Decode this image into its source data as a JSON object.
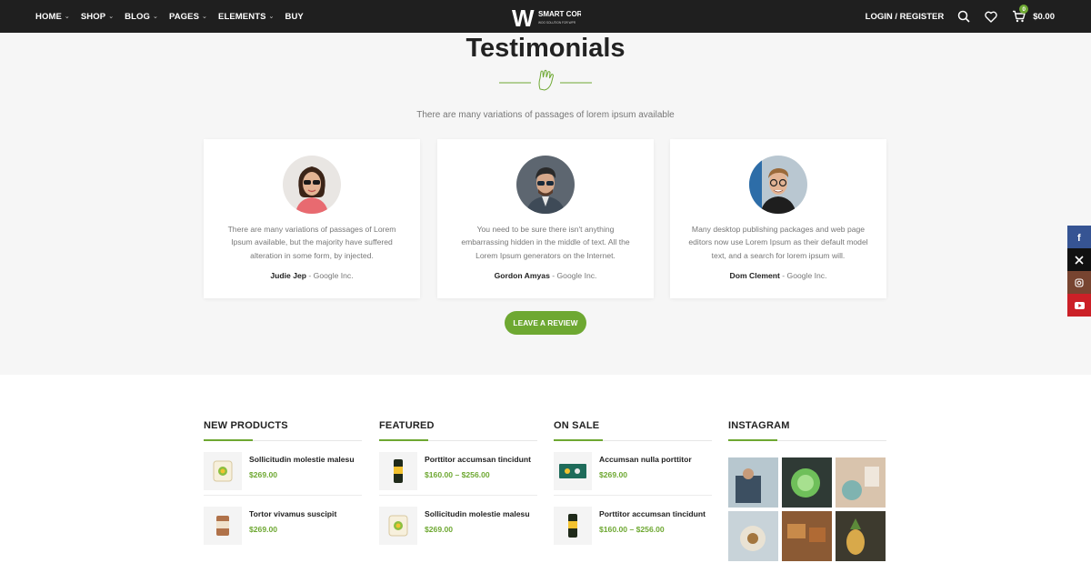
{
  "header": {
    "nav": [
      {
        "label": "HOME",
        "caret": true
      },
      {
        "label": "SHOP",
        "caret": true
      },
      {
        "label": "BLOG",
        "caret": true
      },
      {
        "label": "PAGES",
        "caret": true
      },
      {
        "label": "ELEMENTS",
        "caret": true
      },
      {
        "label": "BUY",
        "caret": false
      }
    ],
    "logo": {
      "mark": "W",
      "name": "SMART CORP",
      "tagline": "WOO SOLUTION FOR WPR"
    },
    "login_label": "LOGIN / REGISTER",
    "cart_count": "0",
    "cart_total": "$0.00",
    "icons": [
      "search-icon",
      "heart-icon",
      "cart-icon"
    ]
  },
  "testimonials": {
    "title": "Testimonials",
    "subtitle": "There are many variations of passages of lorem ipsum available",
    "items": [
      {
        "quote": "There are many variations of passages of Lorem Ipsum available, but the majority have suffered alteration in some form, by injected.",
        "name": "Judie Jep",
        "company": " - Google Inc."
      },
      {
        "quote": "You need to be sure there isn't anything embarrassing hidden in the middle of text. All the Lorem Ipsum generators on the Internet.",
        "name": "Gordon Amyas",
        "company": " - Google Inc."
      },
      {
        "quote": "Many desktop publishing packages and web page editors now use Lorem Ipsum as their default model text, and a search for lorem ipsum will.",
        "name": "Dom Clement",
        "company": " - Google Inc."
      }
    ],
    "button_label": "LEAVE A REVIEW"
  },
  "social": [
    {
      "icon": "facebook-icon",
      "glyph": "f",
      "color": "#365493"
    },
    {
      "icon": "x-icon",
      "glyph": "X",
      "color": "#111111"
    },
    {
      "icon": "instagram-icon",
      "glyph": "◎",
      "color": "#774430"
    },
    {
      "icon": "youtube-icon",
      "glyph": "▶",
      "color": "#cb2027"
    }
  ],
  "columns": {
    "new_products": {
      "title": "NEW PRODUCTS",
      "items": [
        {
          "name": "Sollicitudin molestie malesu",
          "price": "$269.00"
        },
        {
          "name": "Tortor vivamus suscipit",
          "price": "$269.00"
        }
      ]
    },
    "featured": {
      "title": "FEATURED",
      "items": [
        {
          "name": "Porttitor accumsan tincidunt",
          "price": "$160.00 – $256.00"
        },
        {
          "name": "Sollicitudin molestie malesu",
          "price": "$269.00"
        }
      ]
    },
    "on_sale": {
      "title": "ON SALE",
      "items": [
        {
          "name": "Accumsan nulla porttitor",
          "price": "$269.00"
        },
        {
          "name": "Porttitor accumsan tincidunt",
          "price": "$160.00 – $256.00"
        }
      ]
    },
    "instagram": {
      "title": "INSTAGRAM"
    }
  },
  "colors": {
    "accent": "#6ea832",
    "header_bg": "#1f1f1f",
    "section_bg": "#f6f6f6"
  }
}
